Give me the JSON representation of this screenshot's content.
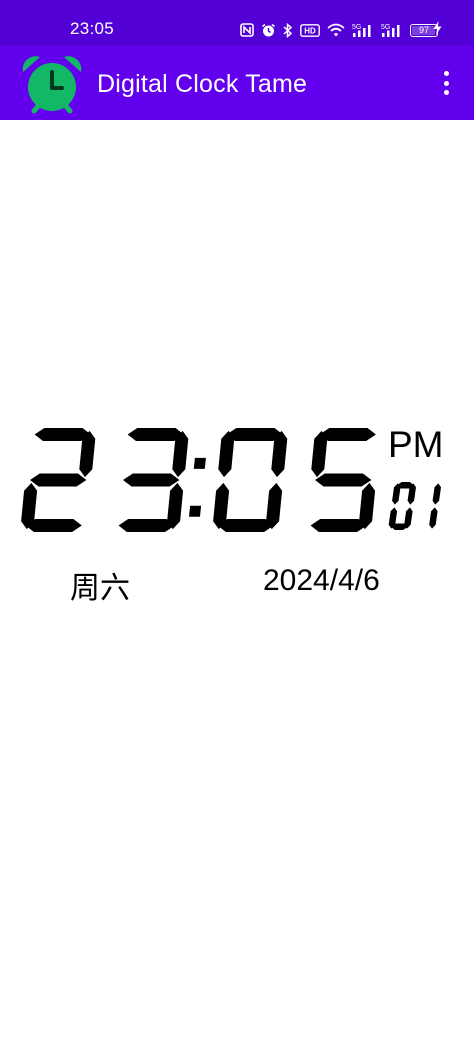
{
  "status_bar": {
    "time": "23:05",
    "network_5g_1": "5G",
    "network_5g_2": "5G",
    "hd_label": "HD",
    "battery_level": 97,
    "icons": [
      "nfc-icon",
      "alarm-icon",
      "bluetooth-icon",
      "hd-voice-icon",
      "wifi-icon",
      "signal-icon",
      "signal-icon",
      "battery-icon",
      "charging-icon"
    ]
  },
  "app_bar": {
    "title": "Digital Clock Tame",
    "logo_icon": "alarm-clock-icon",
    "menu_icon": "more-vert-icon",
    "colors": {
      "status_bar": "#5200d6",
      "app_bar": "#6200ee",
      "logo": "#12b865"
    }
  },
  "clock": {
    "time": "23:05",
    "seconds": "01",
    "am_pm": "PM",
    "weekday": "周六",
    "date": "2024/4/6"
  }
}
